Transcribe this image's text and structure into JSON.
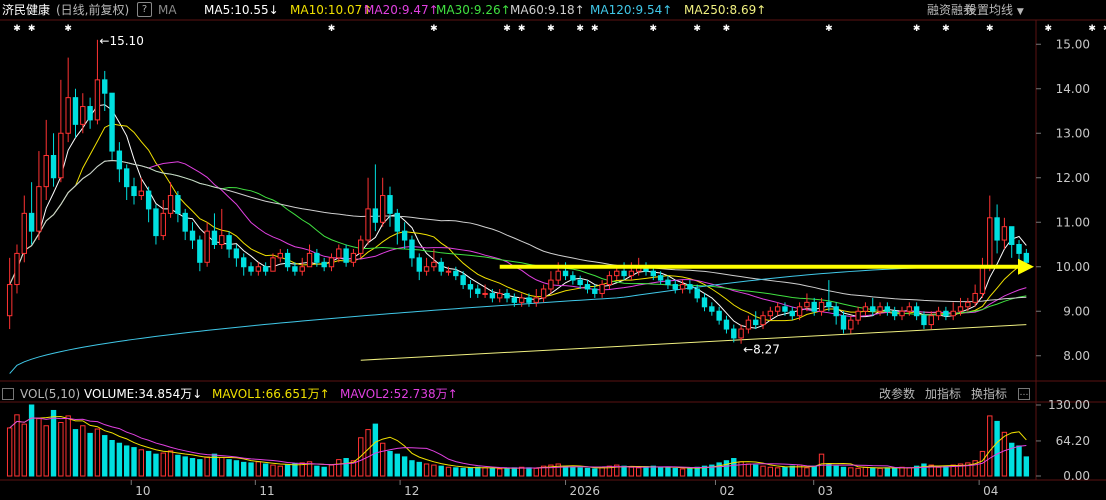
{
  "header": {
    "stock_name": "济民健康",
    "period": "(日线,前复权)",
    "help_icon": "?",
    "ma_label": "MA",
    "ma_lines": [
      {
        "text": "MA5:10.55",
        "arrow": "↓",
        "color": "#ffffff"
      },
      {
        "text": "MA10:10.07",
        "arrow": "↑",
        "color": "#f0e000"
      },
      {
        "text": "MA20:9.47",
        "arrow": "↑",
        "color": "#e040e0"
      },
      {
        "text": "MA30:9.26",
        "arrow": "↑",
        "color": "#40e040"
      },
      {
        "text": "MA60:9.18",
        "arrow": "↑",
        "color": "#cfcfcf"
      },
      {
        "text": "MA120:9.54",
        "arrow": "↑",
        "color": "#40c8e8"
      },
      {
        "text": "MA250:8.69",
        "arrow": "↑",
        "color": "#f0f080"
      }
    ],
    "margin_label": "融资融券",
    "settings_label": "设置均线"
  },
  "volume_header": {
    "label": "VOL(5,10)",
    "volume": "VOLUME:34.854万",
    "volume_arrow": "↓",
    "mavol1": "MAVOL1:66.651万",
    "mavol1_arrow": "↑",
    "mavol2": "MAVOL2:52.738万",
    "mavol2_arrow": "↑",
    "btn_params": "改参数",
    "btn_add": "加指标",
    "btn_switch": "换指标",
    "colors": {
      "volume": "#ffffff",
      "mavol1": "#f0e000",
      "mavol2": "#e040e0"
    }
  },
  "price_axis": {
    "ticks": [
      "15.00",
      "14.00",
      "13.00",
      "12.00",
      "11.00",
      "10.00",
      "9.00",
      "8.00"
    ]
  },
  "volume_axis": {
    "ticks": [
      "130.00",
      "64.20",
      "0.00"
    ]
  },
  "time_axis": {
    "labels": [
      "10",
      "11",
      "12",
      "2026",
      "02",
      "03",
      "04"
    ]
  },
  "annotations": {
    "high": "15.10",
    "low": "8.27"
  },
  "chart_data": {
    "type": "candlestick",
    "price_range": [
      7.5,
      15.5
    ],
    "volume_range": [
      0,
      130
    ],
    "candles": [
      [
        8.9,
        9.6,
        10.2,
        8.6
      ],
      [
        9.6,
        10.3,
        10.5,
        9.4
      ],
      [
        10.3,
        11.2,
        11.6,
        10.1
      ],
      [
        11.2,
        10.8,
        11.9,
        10.5
      ],
      [
        10.8,
        11.8,
        12.6,
        10.6
      ],
      [
        11.8,
        12.5,
        13.3,
        11.5
      ],
      [
        12.5,
        12.0,
        13.0,
        11.8
      ],
      [
        12.0,
        13.0,
        14.2,
        11.9
      ],
      [
        13.0,
        13.8,
        14.7,
        12.8
      ],
      [
        13.8,
        13.2,
        14.0,
        12.9
      ],
      [
        13.2,
        13.6,
        13.9,
        13.0
      ],
      [
        13.6,
        13.3,
        13.8,
        13.1
      ],
      [
        13.3,
        14.2,
        15.1,
        13.2
      ],
      [
        14.2,
        13.9,
        14.4,
        13.5
      ],
      [
        13.9,
        12.6,
        13.7,
        12.4
      ],
      [
        12.6,
        12.2,
        12.8,
        11.9
      ],
      [
        12.2,
        11.8,
        12.3,
        11.5
      ],
      [
        11.8,
        11.6,
        12.0,
        11.4
      ],
      [
        11.6,
        11.7,
        12.0,
        11.5
      ],
      [
        11.7,
        11.3,
        11.8,
        11.0
      ],
      [
        11.3,
        10.7,
        11.4,
        10.5
      ],
      [
        10.7,
        11.2,
        11.5,
        10.6
      ],
      [
        11.2,
        11.6,
        11.9,
        11.1
      ],
      [
        11.6,
        11.2,
        11.7,
        11.0
      ],
      [
        11.2,
        10.8,
        11.3,
        10.6
      ],
      [
        10.8,
        10.6,
        11.0,
        10.4
      ],
      [
        10.6,
        10.1,
        10.7,
        9.9
      ],
      [
        10.1,
        10.8,
        11.0,
        10.0
      ],
      [
        10.8,
        10.5,
        11.2,
        10.4
      ],
      [
        10.5,
        10.7,
        11.3,
        10.4
      ],
      [
        10.7,
        10.4,
        10.8,
        10.2
      ],
      [
        10.4,
        10.2,
        10.5,
        10.0
      ],
      [
        10.2,
        10.0,
        10.3,
        9.8
      ],
      [
        10.0,
        9.9,
        10.1,
        9.8
      ],
      [
        9.9,
        10.0,
        10.1,
        9.8
      ],
      [
        10.0,
        9.9,
        10.1,
        9.8
      ],
      [
        9.9,
        10.2,
        10.3,
        9.9
      ],
      [
        10.2,
        10.3,
        10.4,
        10.1
      ],
      [
        10.3,
        10.0,
        10.4,
        9.9
      ],
      [
        10.0,
        9.9,
        10.1,
        9.8
      ],
      [
        9.9,
        10.0,
        10.2,
        9.8
      ],
      [
        10.0,
        10.3,
        10.5,
        10.0
      ],
      [
        10.3,
        10.1,
        10.4,
        10.0
      ],
      [
        10.1,
        10.0,
        10.2,
        9.9
      ],
      [
        10.0,
        10.2,
        10.3,
        9.9
      ],
      [
        10.2,
        10.4,
        10.5,
        10.1
      ],
      [
        10.4,
        10.1,
        10.5,
        10.0
      ],
      [
        10.1,
        10.3,
        10.4,
        10.0
      ],
      [
        10.3,
        10.6,
        10.7,
        10.2
      ],
      [
        10.6,
        11.3,
        12.0,
        10.5
      ],
      [
        11.3,
        11.0,
        12.3,
        10.8
      ],
      [
        11.0,
        11.6,
        12.0,
        10.9
      ],
      [
        11.6,
        11.2,
        11.8,
        10.9
      ],
      [
        11.2,
        10.8,
        11.3,
        10.5
      ],
      [
        10.8,
        10.6,
        11.0,
        10.4
      ],
      [
        10.6,
        10.2,
        10.7,
        10.0
      ],
      [
        10.2,
        9.9,
        10.3,
        9.7
      ],
      [
        9.9,
        10.0,
        10.2,
        9.8
      ],
      [
        10.0,
        10.1,
        10.4,
        9.9
      ],
      [
        10.1,
        9.9,
        10.2,
        9.8
      ],
      [
        9.9,
        9.9,
        10.0,
        9.8
      ],
      [
        9.9,
        9.8,
        10.0,
        9.7
      ],
      [
        9.8,
        9.6,
        9.9,
        9.5
      ],
      [
        9.6,
        9.5,
        9.7,
        9.3
      ],
      [
        9.5,
        9.4,
        9.6,
        9.3
      ],
      [
        9.4,
        9.4,
        9.6,
        9.3
      ],
      [
        9.4,
        9.3,
        9.5,
        9.2
      ],
      [
        9.3,
        9.4,
        9.5,
        9.2
      ],
      [
        9.4,
        9.3,
        9.5,
        9.2
      ],
      [
        9.3,
        9.2,
        9.4,
        9.1
      ],
      [
        9.2,
        9.3,
        9.4,
        9.1
      ],
      [
        9.3,
        9.2,
        9.4,
        9.1
      ],
      [
        9.2,
        9.3,
        9.5,
        9.1
      ],
      [
        9.3,
        9.5,
        9.6,
        9.2
      ],
      [
        9.5,
        9.7,
        9.9,
        9.4
      ],
      [
        9.7,
        9.9,
        10.1,
        9.6
      ],
      [
        9.9,
        9.8,
        10.1,
        9.7
      ],
      [
        9.8,
        9.7,
        9.9,
        9.6
      ],
      [
        9.7,
        9.6,
        9.8,
        9.5
      ],
      [
        9.6,
        9.5,
        9.7,
        9.4
      ],
      [
        9.5,
        9.4,
        9.6,
        9.3
      ],
      [
        9.4,
        9.6,
        9.7,
        9.3
      ],
      [
        9.6,
        9.8,
        9.9,
        9.5
      ],
      [
        9.8,
        9.9,
        10.0,
        9.7
      ],
      [
        9.9,
        9.8,
        10.1,
        9.7
      ],
      [
        9.8,
        9.9,
        10.1,
        9.7
      ],
      [
        9.9,
        10.0,
        10.2,
        9.8
      ],
      [
        10.0,
        9.9,
        10.1,
        9.8
      ],
      [
        9.9,
        9.8,
        10.0,
        9.7
      ],
      [
        9.8,
        9.7,
        9.9,
        9.6
      ],
      [
        9.7,
        9.6,
        9.8,
        9.5
      ],
      [
        9.6,
        9.5,
        9.7,
        9.4
      ],
      [
        9.5,
        9.6,
        9.7,
        9.4
      ],
      [
        9.6,
        9.5,
        9.7,
        9.4
      ],
      [
        9.5,
        9.3,
        9.6,
        9.2
      ],
      [
        9.3,
        9.1,
        9.4,
        9.0
      ],
      [
        9.1,
        9.0,
        9.2,
        8.9
      ],
      [
        9.0,
        8.8,
        9.1,
        8.7
      ],
      [
        8.8,
        8.6,
        8.9,
        8.5
      ],
      [
        8.6,
        8.4,
        8.7,
        8.3
      ],
      [
        8.4,
        8.6,
        8.7,
        8.27
      ],
      [
        8.6,
        8.8,
        8.9,
        8.5
      ],
      [
        8.8,
        8.7,
        9.0,
        8.6
      ],
      [
        8.7,
        8.9,
        9.0,
        8.6
      ],
      [
        8.9,
        9.0,
        9.1,
        8.8
      ],
      [
        9.0,
        9.1,
        9.2,
        8.9
      ],
      [
        9.1,
        9.0,
        9.2,
        8.9
      ],
      [
        9.0,
        8.9,
        9.1,
        8.8
      ],
      [
        8.9,
        9.1,
        9.2,
        8.8
      ],
      [
        9.1,
        9.2,
        9.4,
        9.0
      ],
      [
        9.2,
        9.0,
        9.3,
        8.9
      ],
      [
        9.0,
        9.2,
        9.3,
        8.9
      ],
      [
        9.2,
        9.1,
        9.7,
        9.0
      ],
      [
        9.1,
        8.9,
        9.2,
        8.7
      ],
      [
        8.9,
        8.6,
        9.0,
        8.5
      ],
      [
        8.6,
        8.8,
        8.9,
        8.5
      ],
      [
        8.8,
        9.0,
        9.1,
        8.7
      ],
      [
        9.0,
        9.1,
        9.2,
        8.9
      ],
      [
        9.1,
        9.0,
        9.3,
        8.9
      ],
      [
        9.0,
        9.1,
        9.2,
        8.9
      ],
      [
        9.1,
        9.0,
        9.2,
        8.9
      ],
      [
        9.0,
        8.9,
        9.1,
        8.8
      ],
      [
        8.9,
        9.0,
        9.1,
        8.8
      ],
      [
        9.0,
        9.1,
        9.2,
        8.9
      ],
      [
        9.1,
        8.9,
        9.2,
        8.8
      ],
      [
        8.9,
        8.7,
        9.0,
        8.6
      ],
      [
        8.7,
        8.9,
        9.0,
        8.6
      ],
      [
        8.9,
        9.0,
        9.1,
        8.8
      ],
      [
        9.0,
        8.9,
        9.1,
        8.8
      ],
      [
        8.9,
        9.0,
        9.2,
        8.8
      ],
      [
        9.0,
        9.1,
        9.3,
        8.9
      ],
      [
        9.1,
        9.2,
        9.3,
        9.0
      ],
      [
        9.2,
        9.4,
        9.6,
        9.1
      ],
      [
        9.4,
        10.0,
        10.2,
        9.3
      ],
      [
        10.0,
        11.1,
        11.6,
        9.9
      ],
      [
        11.1,
        10.6,
        11.4,
        10.3
      ],
      [
        10.6,
        10.9,
        11.1,
        10.4
      ],
      [
        10.9,
        10.5,
        10.9,
        10.2
      ],
      [
        10.5,
        10.3,
        10.6,
        10.1
      ],
      [
        10.3,
        10.1,
        10.4,
        10.0
      ]
    ],
    "volumes": [
      88,
      112,
      95,
      130,
      105,
      92,
      120,
      98,
      110,
      85,
      92,
      78,
      86,
      74,
      65,
      60,
      55,
      52,
      48,
      45,
      40,
      42,
      46,
      38,
      35,
      32,
      30,
      35,
      40,
      34,
      30,
      28,
      25,
      24,
      26,
      22,
      20,
      18,
      20,
      22,
      24,
      26,
      18,
      16,
      20,
      30,
      32,
      28,
      70,
      85,
      95,
      60,
      45,
      40,
      35,
      28,
      25,
      22,
      20,
      18,
      16,
      15,
      14,
      15,
      16,
      15,
      14,
      13,
      14,
      15,
      16,
      15,
      14,
      18,
      20,
      22,
      18,
      16,
      15,
      14,
      13,
      16,
      18,
      20,
      18,
      16,
      15,
      17,
      18,
      16,
      15,
      14,
      13,
      15,
      16,
      18,
      20,
      24,
      28,
      32,
      26,
      22,
      20,
      18,
      16,
      15,
      16,
      18,
      20,
      15,
      18,
      40,
      22,
      18,
      16,
      15,
      14,
      16,
      15,
      14,
      15,
      14,
      16,
      15,
      18,
      22,
      20,
      16,
      18,
      20,
      22,
      24,
      28,
      45,
      110,
      100,
      80,
      60,
      55,
      35
    ]
  },
  "support_line_start_end": [
    7.9,
    8.7
  ],
  "resistance_line_value": 10.0
}
